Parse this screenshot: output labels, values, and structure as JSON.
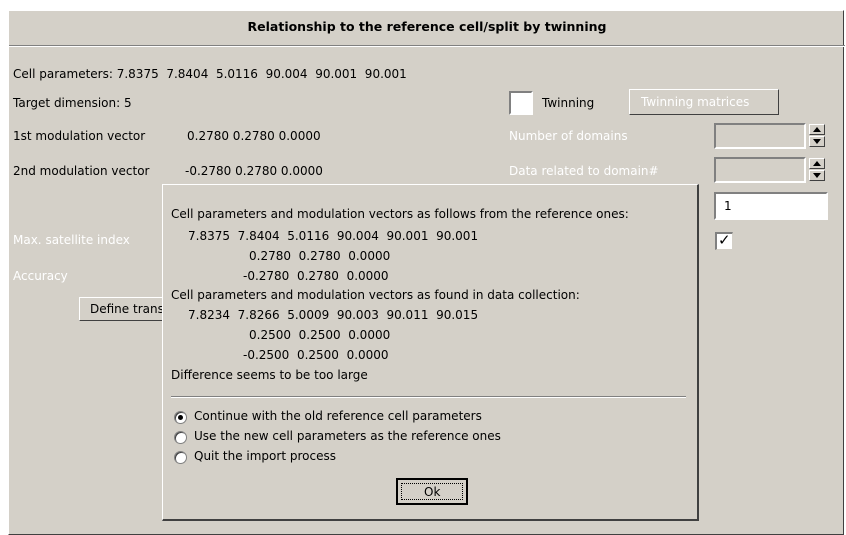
{
  "window": {
    "title": "Relationship to the reference cell/split by twinning",
    "cell_parameters_label": "Cell parameters:",
    "cell_parameters_value": "7.8375  7.8404  5.0116  90.004  90.001  90.001",
    "target_dimension": "Target dimension: 5",
    "mod1_label": "1st modulation vector",
    "mod1_value": "0.2780 0.2780 0.0000",
    "mod2_label": "2nd modulation vector",
    "mod2_value": "-0.2780 0.2780 0.0000",
    "max_satellite_label": "Max. satellite index",
    "accuracy_label": "Accuracy",
    "define_button_label": "Define transf",
    "twinning_label": "Twinning",
    "twinning_matrices_button": "Twinning matrices",
    "number_of_domains_label": "Number of domains",
    "data_related_label": "Data related to domain#",
    "max_satellite_value": "1",
    "checkbox_mark": "✓"
  },
  "dialog": {
    "heading_reference": "Cell parameters and modulation vectors as follows from the reference ones:",
    "ref_cell": "7.8375  7.8404  5.0116  90.004  90.001  90.001",
    "ref_mod1": "0.2780  0.2780  0.0000",
    "ref_mod2": "-0.2780  0.2780  0.0000",
    "heading_found": "Cell parameters and modulation vectors as found in data collection:",
    "found_cell": "7.8234  7.8266  5.0009  90.003  90.011  90.015",
    "found_mod1": "0.2500  0.2500  0.0000",
    "found_mod2": "-0.2500  0.2500  0.0000",
    "difference_note": "Difference seems to be too large",
    "options": [
      {
        "label": "Continue with the old reference cell parameters",
        "selected": true
      },
      {
        "label": "Use the new cell parameters as the reference ones",
        "selected": false
      },
      {
        "label": "Quit the import process",
        "selected": false
      }
    ],
    "ok_label": "Ok"
  }
}
